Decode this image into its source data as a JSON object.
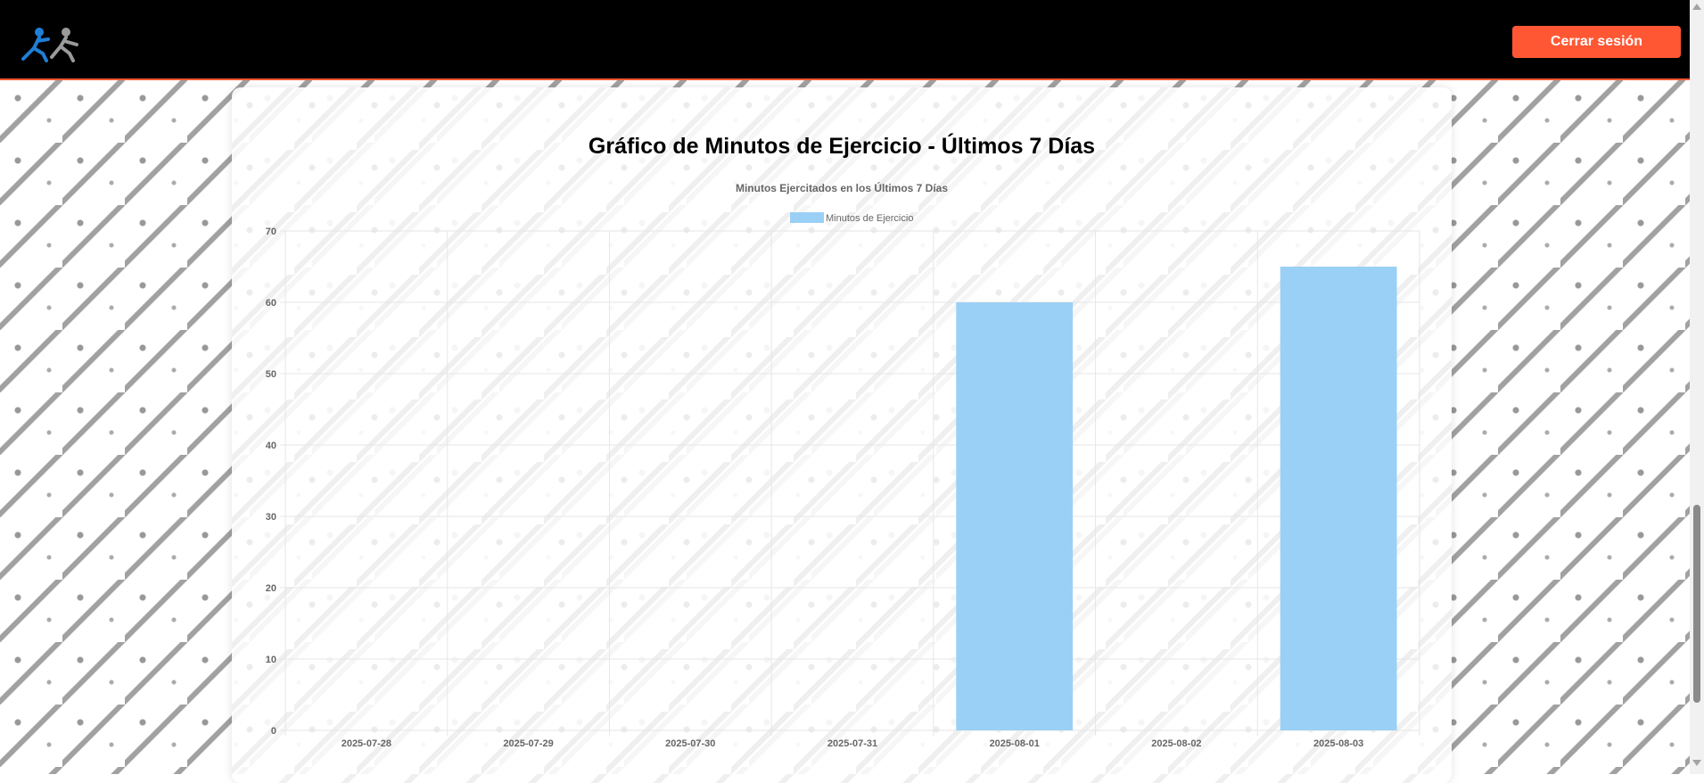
{
  "header": {
    "logout_label": "Cerrar sesión"
  },
  "page": {
    "title": "Gráfico de Minutos de Ejercicio - Últimos 7 Días"
  },
  "colors": {
    "header_bg": "#000000",
    "accent": "#ff5733",
    "bar_fill": "#9ad0f5",
    "grid": "#e6e6e6",
    "text": "#666666"
  },
  "chart_data": {
    "type": "bar",
    "title": "Minutos Ejercitados en los Últimos 7 Días",
    "categories": [
      "2025-07-28",
      "2025-07-29",
      "2025-07-30",
      "2025-07-31",
      "2025-08-01",
      "2025-08-02",
      "2025-08-03"
    ],
    "series": [
      {
        "name": "Minutos de Ejercicio",
        "values": [
          0,
          0,
          0,
          0,
          60,
          0,
          65
        ]
      }
    ],
    "ylim": [
      0,
      70
    ],
    "yticks": [
      0,
      10,
      20,
      30,
      40,
      50,
      60,
      70
    ],
    "grid": true,
    "legend": "top-center"
  }
}
